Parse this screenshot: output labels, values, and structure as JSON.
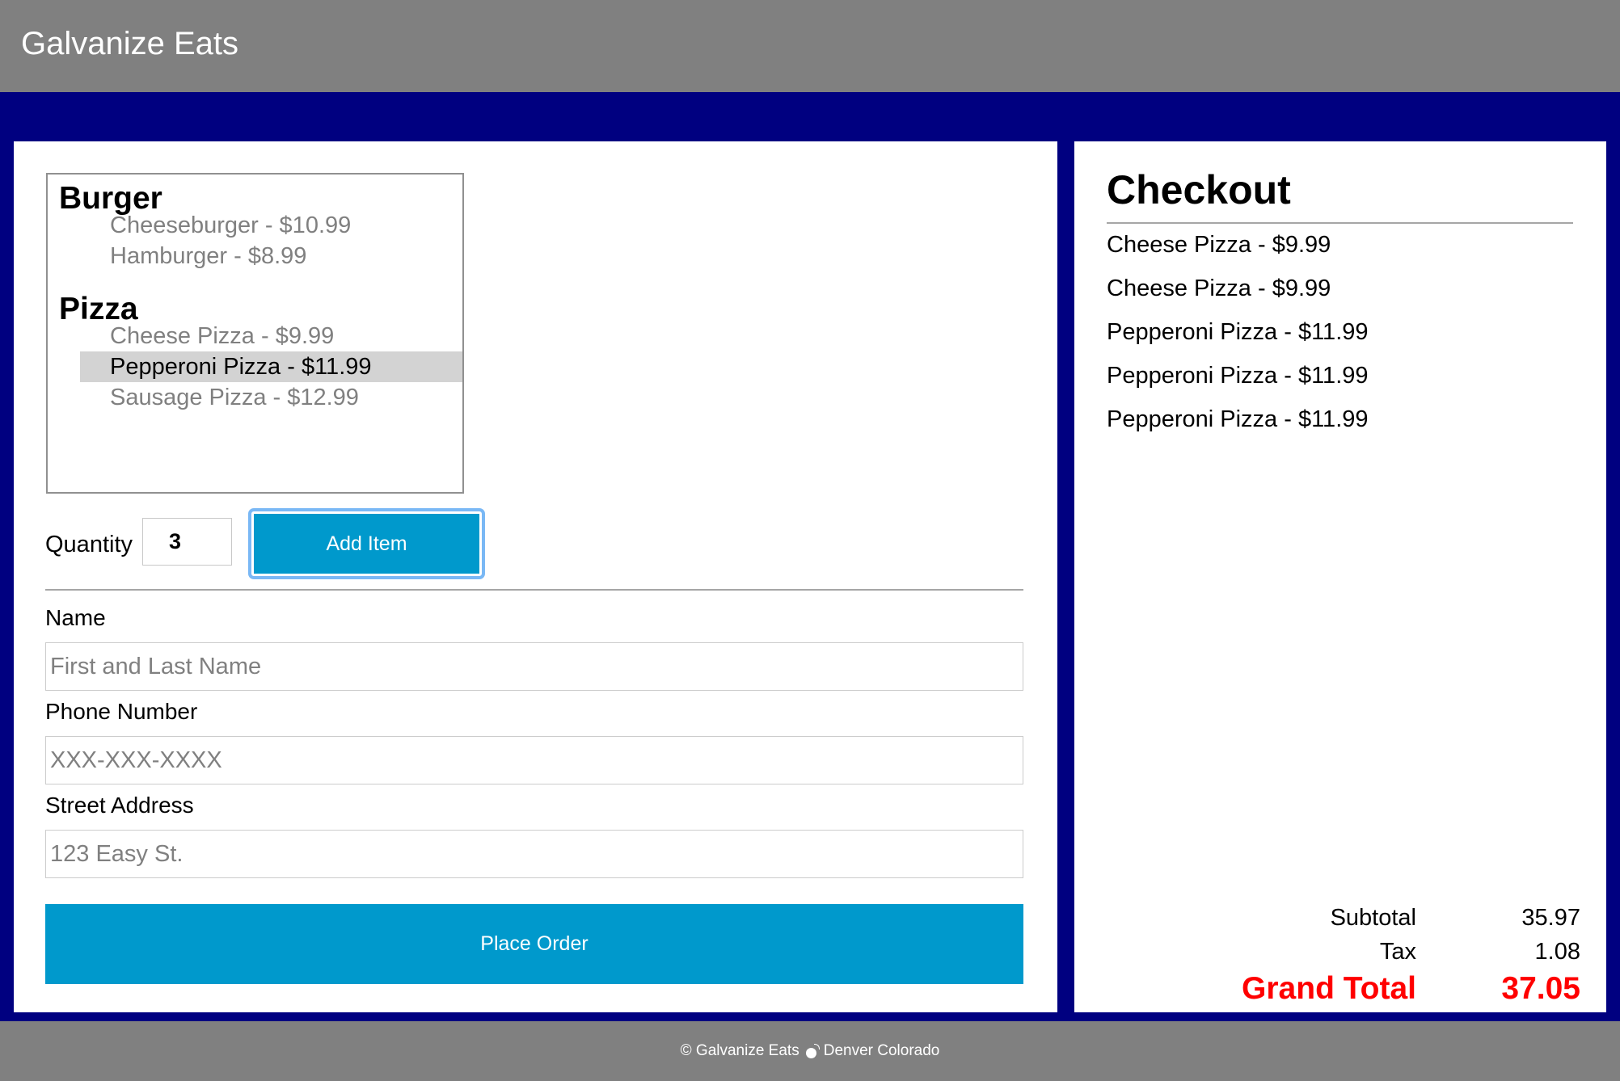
{
  "app": {
    "title": "Galvanize Eats"
  },
  "menu": {
    "groups": [
      {
        "label": "Burger",
        "items": [
          {
            "label": "Cheeseburger - $10.99"
          },
          {
            "label": "Hamburger - $8.99"
          }
        ]
      },
      {
        "label": "Pizza",
        "items": [
          {
            "label": "Cheese Pizza - $9.99"
          },
          {
            "label": "Pepperoni Pizza - $11.99"
          },
          {
            "label": "Sausage Pizza - $12.99"
          }
        ]
      }
    ],
    "selected": "Pepperoni Pizza - $11.99"
  },
  "quantity": {
    "label": "Quantity",
    "value": "3"
  },
  "add_button": {
    "label": "Add Item"
  },
  "form": {
    "name_label": "Name",
    "name_placeholder": "First and Last Name",
    "phone_label": "Phone Number",
    "phone_placeholder": "XXX-XXX-XXXX",
    "address_label": "Street Address",
    "address_placeholder": "123 Easy St."
  },
  "place_order": {
    "label": "Place Order"
  },
  "checkout": {
    "title": "Checkout",
    "items": [
      "Cheese Pizza - $9.99",
      "Cheese Pizza - $9.99",
      "Pepperoni Pizza - $11.99",
      "Pepperoni Pizza - $11.99",
      "Pepperoni Pizza - $11.99"
    ],
    "subtotal_label": "Subtotal",
    "subtotal": "35.97",
    "tax_label": "Tax",
    "tax": "1.08",
    "grand_total_label": "Grand Total",
    "grand_total": "37.05"
  },
  "footer": {
    "copyright": "© Galvanize Eats",
    "location": "Denver Colorado",
    "icon": "bomb-icon"
  },
  "colors": {
    "header_bg": "#808080",
    "page_bg": "#000080",
    "button_bg": "#0099cc",
    "grand_total": "#ff0000",
    "selected_option_bg": "#d3d3d3"
  }
}
